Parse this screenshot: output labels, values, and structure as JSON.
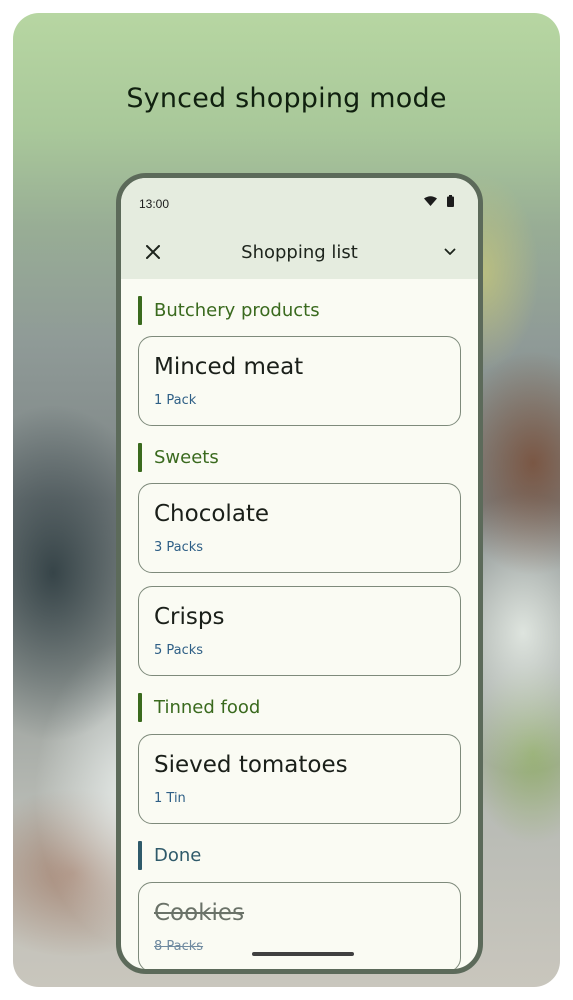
{
  "headline": "Synced shopping mode",
  "status_bar": {
    "time": "13:00",
    "icons": [
      "wifi-icon",
      "battery-icon"
    ]
  },
  "top_bar": {
    "title": "Shopping list",
    "close_icon": "close-icon",
    "expand_icon": "chevron-down-icon"
  },
  "colors": {
    "section_accent": "#3a6a1e",
    "done_accent": "#2f5a6a",
    "quantity_text": "#2e5f86",
    "app_background": "#fafbf3",
    "top_bar_background": "#e5ecdf"
  },
  "sections": [
    {
      "title": "Butchery products",
      "items": [
        {
          "name": "Minced meat",
          "quantity": "1 Pack"
        }
      ]
    },
    {
      "title": "Sweets",
      "items": [
        {
          "name": "Chocolate",
          "quantity": "3 Packs"
        },
        {
          "name": "Crisps",
          "quantity": "5 Packs"
        }
      ]
    },
    {
      "title": "Tinned food",
      "items": [
        {
          "name": "Sieved tomatoes",
          "quantity": "1 Tin"
        }
      ]
    },
    {
      "title": "Done",
      "items": [
        {
          "name": "Cookies",
          "quantity": "8 Packs"
        }
      ]
    }
  ]
}
